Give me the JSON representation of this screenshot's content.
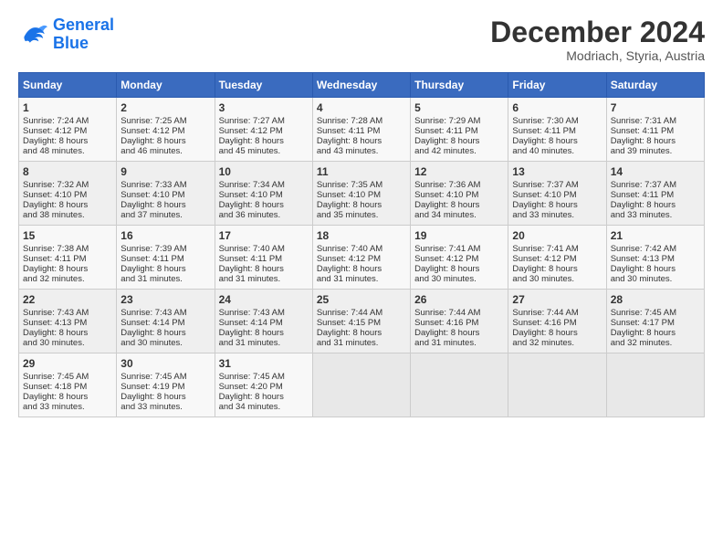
{
  "logo": {
    "line1": "General",
    "line2": "Blue"
  },
  "title": "December 2024",
  "subtitle": "Modriach, Styria, Austria",
  "days_of_week": [
    "Sunday",
    "Monday",
    "Tuesday",
    "Wednesday",
    "Thursday",
    "Friday",
    "Saturday"
  ],
  "weeks": [
    [
      {
        "day": "1",
        "lines": [
          "Sunrise: 7:24 AM",
          "Sunset: 4:12 PM",
          "Daylight: 8 hours",
          "and 48 minutes."
        ]
      },
      {
        "day": "2",
        "lines": [
          "Sunrise: 7:25 AM",
          "Sunset: 4:12 PM",
          "Daylight: 8 hours",
          "and 46 minutes."
        ]
      },
      {
        "day": "3",
        "lines": [
          "Sunrise: 7:27 AM",
          "Sunset: 4:12 PM",
          "Daylight: 8 hours",
          "and 45 minutes."
        ]
      },
      {
        "day": "4",
        "lines": [
          "Sunrise: 7:28 AM",
          "Sunset: 4:11 PM",
          "Daylight: 8 hours",
          "and 43 minutes."
        ]
      },
      {
        "day": "5",
        "lines": [
          "Sunrise: 7:29 AM",
          "Sunset: 4:11 PM",
          "Daylight: 8 hours",
          "and 42 minutes."
        ]
      },
      {
        "day": "6",
        "lines": [
          "Sunrise: 7:30 AM",
          "Sunset: 4:11 PM",
          "Daylight: 8 hours",
          "and 40 minutes."
        ]
      },
      {
        "day": "7",
        "lines": [
          "Sunrise: 7:31 AM",
          "Sunset: 4:11 PM",
          "Daylight: 8 hours",
          "and 39 minutes."
        ]
      }
    ],
    [
      {
        "day": "8",
        "lines": [
          "Sunrise: 7:32 AM",
          "Sunset: 4:10 PM",
          "Daylight: 8 hours",
          "and 38 minutes."
        ]
      },
      {
        "day": "9",
        "lines": [
          "Sunrise: 7:33 AM",
          "Sunset: 4:10 PM",
          "Daylight: 8 hours",
          "and 37 minutes."
        ]
      },
      {
        "day": "10",
        "lines": [
          "Sunrise: 7:34 AM",
          "Sunset: 4:10 PM",
          "Daylight: 8 hours",
          "and 36 minutes."
        ]
      },
      {
        "day": "11",
        "lines": [
          "Sunrise: 7:35 AM",
          "Sunset: 4:10 PM",
          "Daylight: 8 hours",
          "and 35 minutes."
        ]
      },
      {
        "day": "12",
        "lines": [
          "Sunrise: 7:36 AM",
          "Sunset: 4:10 PM",
          "Daylight: 8 hours",
          "and 34 minutes."
        ]
      },
      {
        "day": "13",
        "lines": [
          "Sunrise: 7:37 AM",
          "Sunset: 4:10 PM",
          "Daylight: 8 hours",
          "and 33 minutes."
        ]
      },
      {
        "day": "14",
        "lines": [
          "Sunrise: 7:37 AM",
          "Sunset: 4:11 PM",
          "Daylight: 8 hours",
          "and 33 minutes."
        ]
      }
    ],
    [
      {
        "day": "15",
        "lines": [
          "Sunrise: 7:38 AM",
          "Sunset: 4:11 PM",
          "Daylight: 8 hours",
          "and 32 minutes."
        ]
      },
      {
        "day": "16",
        "lines": [
          "Sunrise: 7:39 AM",
          "Sunset: 4:11 PM",
          "Daylight: 8 hours",
          "and 31 minutes."
        ]
      },
      {
        "day": "17",
        "lines": [
          "Sunrise: 7:40 AM",
          "Sunset: 4:11 PM",
          "Daylight: 8 hours",
          "and 31 minutes."
        ]
      },
      {
        "day": "18",
        "lines": [
          "Sunrise: 7:40 AM",
          "Sunset: 4:12 PM",
          "Daylight: 8 hours",
          "and 31 minutes."
        ]
      },
      {
        "day": "19",
        "lines": [
          "Sunrise: 7:41 AM",
          "Sunset: 4:12 PM",
          "Daylight: 8 hours",
          "and 30 minutes."
        ]
      },
      {
        "day": "20",
        "lines": [
          "Sunrise: 7:41 AM",
          "Sunset: 4:12 PM",
          "Daylight: 8 hours",
          "and 30 minutes."
        ]
      },
      {
        "day": "21",
        "lines": [
          "Sunrise: 7:42 AM",
          "Sunset: 4:13 PM",
          "Daylight: 8 hours",
          "and 30 minutes."
        ]
      }
    ],
    [
      {
        "day": "22",
        "lines": [
          "Sunrise: 7:43 AM",
          "Sunset: 4:13 PM",
          "Daylight: 8 hours",
          "and 30 minutes."
        ]
      },
      {
        "day": "23",
        "lines": [
          "Sunrise: 7:43 AM",
          "Sunset: 4:14 PM",
          "Daylight: 8 hours",
          "and 30 minutes."
        ]
      },
      {
        "day": "24",
        "lines": [
          "Sunrise: 7:43 AM",
          "Sunset: 4:14 PM",
          "Daylight: 8 hours",
          "and 31 minutes."
        ]
      },
      {
        "day": "25",
        "lines": [
          "Sunrise: 7:44 AM",
          "Sunset: 4:15 PM",
          "Daylight: 8 hours",
          "and 31 minutes."
        ]
      },
      {
        "day": "26",
        "lines": [
          "Sunrise: 7:44 AM",
          "Sunset: 4:16 PM",
          "Daylight: 8 hours",
          "and 31 minutes."
        ]
      },
      {
        "day": "27",
        "lines": [
          "Sunrise: 7:44 AM",
          "Sunset: 4:16 PM",
          "Daylight: 8 hours",
          "and 32 minutes."
        ]
      },
      {
        "day": "28",
        "lines": [
          "Sunrise: 7:45 AM",
          "Sunset: 4:17 PM",
          "Daylight: 8 hours",
          "and 32 minutes."
        ]
      }
    ],
    [
      {
        "day": "29",
        "lines": [
          "Sunrise: 7:45 AM",
          "Sunset: 4:18 PM",
          "Daylight: 8 hours",
          "and 33 minutes."
        ]
      },
      {
        "day": "30",
        "lines": [
          "Sunrise: 7:45 AM",
          "Sunset: 4:19 PM",
          "Daylight: 8 hours",
          "and 33 minutes."
        ]
      },
      {
        "day": "31",
        "lines": [
          "Sunrise: 7:45 AM",
          "Sunset: 4:20 PM",
          "Daylight: 8 hours",
          "and 34 minutes."
        ]
      },
      {
        "day": "",
        "lines": []
      },
      {
        "day": "",
        "lines": []
      },
      {
        "day": "",
        "lines": []
      },
      {
        "day": "",
        "lines": []
      }
    ]
  ]
}
